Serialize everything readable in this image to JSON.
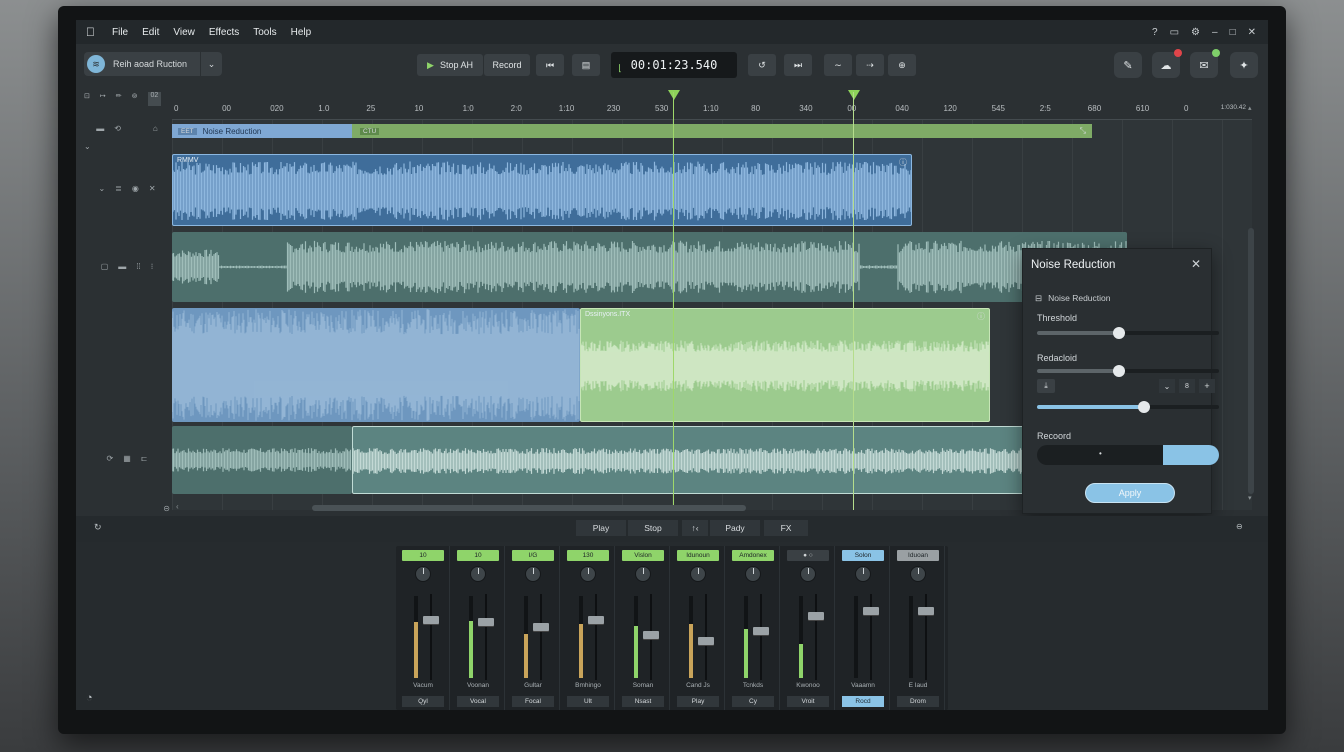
{
  "menu": [
    "File",
    "Edit",
    "View",
    "Effects",
    "Tools",
    "Help"
  ],
  "project": {
    "name": "Reih aoad Ruction"
  },
  "transport_top": {
    "play_label": "Stop AH",
    "record_label": "Record",
    "timecode": "00:01:23.540"
  },
  "ruler_ticks": [
    "0",
    "00",
    "020",
    "1.0",
    "25",
    "10",
    "1:0",
    "2:0",
    "1:10",
    "230",
    "530",
    "1:10",
    "80",
    "340",
    "00",
    "040",
    "120",
    "545",
    "2:5",
    "680",
    "610",
    "0"
  ],
  "ruler_corner": "02",
  "ruler_end": "1:030.42",
  "tracks": {
    "label_clip": "Noise Reduction",
    "label_tag_left": "EET",
    "label_tag_right": "CTU",
    "clip1_title": "RMMV",
    "clip3_title": "Dssinyons.ITX"
  },
  "panel": {
    "title": "Noise Reduction",
    "subtitle": "Noise Reduction",
    "threshold_label": "Threshold",
    "threshold_level": 0.45,
    "reduction_label": "Redacloid",
    "reduction_level": 0.45,
    "stepper_value": "8",
    "amount_level": 0.59,
    "record_label": "Recoord",
    "apply_label": "Apply"
  },
  "transport_bottom": {
    "play": "Play",
    "stop": "Stop",
    "marker": "↑‹",
    "ready": "Pady",
    "fx": "FX"
  },
  "mixer": [
    {
      "top": "10",
      "top_color": "#8fd46a",
      "name": "Vacum",
      "foot": "Qyl",
      "meter": 0.68,
      "fader": 0.3,
      "meter_color": "#c9a45a"
    },
    {
      "top": "10",
      "top_color": "#8fd46a",
      "name": "Voonan",
      "foot": "Vocal",
      "meter": 0.7,
      "fader": 0.32,
      "meter_color": "#8fd46a"
    },
    {
      "top": "I/G",
      "top_color": "#8fd46a",
      "name": "Gultar",
      "foot": "Focal",
      "meter": 0.54,
      "fader": 0.38,
      "meter_color": "#c9a45a"
    },
    {
      "top": "130",
      "top_color": "#8fd46a",
      "name": "Bmhingo",
      "foot": "Ult",
      "meter": 0.66,
      "fader": 0.3,
      "meter_color": "#c9a45a"
    },
    {
      "top": "Vislon",
      "top_color": "#8fd46a",
      "name": "Soman",
      "foot": "Nsast",
      "meter": 0.64,
      "fader": 0.48,
      "meter_color": "#8fd46a"
    },
    {
      "top": "Idunoun",
      "top_color": "#8fd46a",
      "name": "Cand Js",
      "foot": "Play",
      "meter": 0.66,
      "fader": 0.55,
      "meter_color": "#c9a45a"
    },
    {
      "top": "Amdonex",
      "top_color": "#8fd46a",
      "name": "Tcnkds",
      "foot": "Cy",
      "meter": 0.6,
      "fader": 0.43,
      "meter_color": "#8fd46a"
    },
    {
      "top": "● ○",
      "top_color": "#3a4044",
      "name": "Kwonoo",
      "foot": "Vroit",
      "meter": 0.42,
      "fader": 0.25,
      "meter_color": "#8fd46a"
    },
    {
      "top": "Solon",
      "top_color": "#8ac3e6",
      "name": "Vaaamn",
      "foot": "Rocd",
      "meter": 0.0,
      "fader": 0.2,
      "meter_color": "#8fd46a"
    },
    {
      "top": "Iduoan",
      "top_color": "#9aa0a3",
      "name": "E Iaud",
      "foot": "Drom",
      "meter": 0.0,
      "fader": 0.2,
      "meter_color": "#8fd46a"
    }
  ]
}
